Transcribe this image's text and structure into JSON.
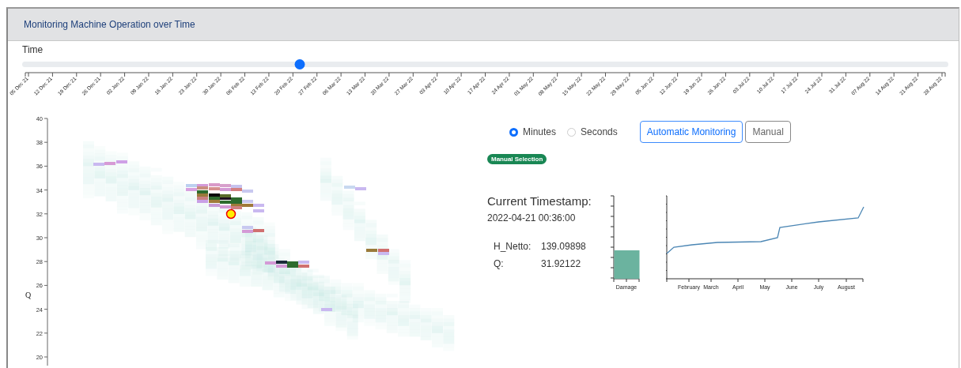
{
  "panel": {
    "title": "Monitoring Machine Operation over Time"
  },
  "time_slider": {
    "label": "Time",
    "level": 0.3,
    "ticks": [
      "05 Dec 21",
      "12 Dec 21",
      "19 Dec 21",
      "26 Dec 21",
      "02 Jan 22",
      "09 Jan 22",
      "16 Jan 22",
      "23 Jan 22",
      "30 Jan 22",
      "06 Feb 22",
      "13 Feb 22",
      "20 Feb 22",
      "27 Feb 22",
      "06 Mar 22",
      "13 Mar 22",
      "20 Mar 22",
      "27 Mar 22",
      "03 Apr 22",
      "10 Apr 22",
      "17 Apr 22",
      "24 Apr 22",
      "01 May 22",
      "08 May 22",
      "15 May 22",
      "22 May 22",
      "29 May 22",
      "05 Jun 22",
      "12 Jun 22",
      "19 Jun 22",
      "26 Jun 22",
      "03 Jul 22",
      "10 Jul 22",
      "17 Jul 22",
      "24 Jul 22",
      "31 Jul 22",
      "07 Aug 22",
      "14 Aug 22",
      "21 Aug 22",
      "28 Aug 22"
    ]
  },
  "heatmap": {
    "y_label": "Q",
    "y_ticks": [
      "40",
      "38",
      "36",
      "34",
      "32",
      "30",
      "28",
      "26",
      "24",
      "22",
      "20"
    ]
  },
  "units": [
    {
      "label": "Minutes",
      "selected": true
    },
    {
      "label": "Seconds",
      "selected": false
    }
  ],
  "modes": [
    {
      "label": "Automatic Monitoring",
      "selected": true
    },
    {
      "label": "Manual",
      "selected": false
    }
  ],
  "badge": "Manual Selection",
  "timestamp": {
    "title": "Current Timestamp:",
    "value": "2022-04-21 00:36:00"
  },
  "readings": [
    {
      "name": "H_Netto:",
      "value": "139.09898"
    },
    {
      "name": "Q:",
      "value": "31.92122"
    }
  ],
  "damage_chart": {
    "label": "Damage"
  },
  "trend_chart": {
    "months": [
      "February",
      "March",
      "April",
      "May",
      "June",
      "July",
      "August"
    ]
  }
}
